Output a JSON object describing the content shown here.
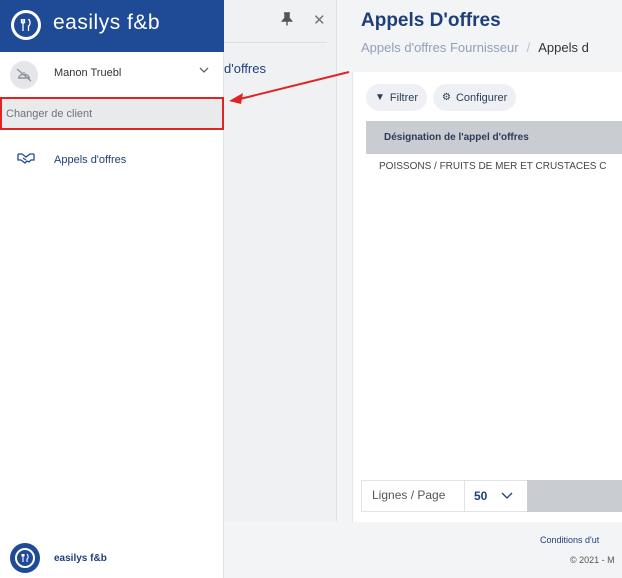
{
  "sidebar": {
    "brand": "easilys f&b",
    "user_name": "Manon Truebl",
    "change_client": "Changer de client",
    "nav_items": [
      {
        "label": "Appels d'offres",
        "icon": "handshake-icon"
      }
    ],
    "footer_brand": "easilys f&b"
  },
  "panel2": {
    "item_partial": "d'offres"
  },
  "main": {
    "title": "Appels D'offres",
    "breadcrumb": [
      "Appels d'offres Fournisseur",
      "/",
      "Appels d"
    ],
    "toolbar": {
      "filter_label": "Filtrer",
      "configure_label": "Configurer"
    },
    "table": {
      "columns": [
        "Désignation de l'appel d'offres"
      ],
      "rows": [
        [
          "POISSONS / FRUITS DE MER ET CRUSTACES C"
        ]
      ]
    },
    "pagination": {
      "rows_per_page_label": "Lignes / Page",
      "rows_per_page_value": "50"
    },
    "footer": {
      "legal": "Conditions d'ut",
      "copyright": "© 2021 - M"
    }
  },
  "colors": {
    "brand_blue": "#1f4a96",
    "highlight_red": "#e02424"
  }
}
